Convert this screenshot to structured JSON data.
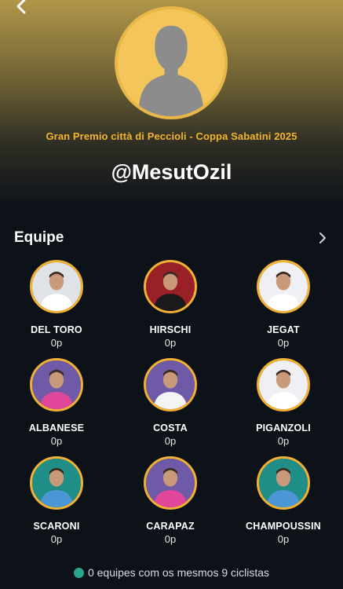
{
  "header": {
    "event_title": "Gran Premio città di Peccioli - Coppa Sabatini 2025",
    "username": "@MesutOzil"
  },
  "team": {
    "section_title": "Equipe",
    "riders": [
      {
        "name": "DEL TORO",
        "points": "0p",
        "jersey_color": "#ffffff",
        "bg": "#dfe3e8"
      },
      {
        "name": "HIRSCHI",
        "points": "0p",
        "jersey_color": "#1a1a1a",
        "bg": "#9a2027"
      },
      {
        "name": "JEGAT",
        "points": "0p",
        "jersey_color": "#ffffff",
        "bg": "#eef0f3"
      },
      {
        "name": "ALBANESE",
        "points": "0p",
        "jersey_color": "#e0479a",
        "bg": "#6e5aa6"
      },
      {
        "name": "COSTA",
        "points": "0p",
        "jersey_color": "#f4f4f4",
        "bg": "#6e5aa6"
      },
      {
        "name": "PIGANZOLI",
        "points": "0p",
        "jersey_color": "#ffffff",
        "bg": "#eef0f3"
      },
      {
        "name": "SCARONI",
        "points": "0p",
        "jersey_color": "#4b97d6",
        "bg": "#1f8e86"
      },
      {
        "name": "CARAPAZ",
        "points": "0p",
        "jersey_color": "#e0479a",
        "bg": "#6e5aa6"
      },
      {
        "name": "CHAMPOUSSIN",
        "points": "0p",
        "jersey_color": "#4b97d6",
        "bg": "#1f8e86"
      }
    ]
  },
  "footer": {
    "text": "0 equipes com os mesmos 9 ciclistas"
  },
  "colors": {
    "accent": "#f2b133",
    "background": "#0d1219",
    "status_dot": "#2aa58d"
  },
  "icons": {
    "back": "chevron-left-icon",
    "section_more": "chevron-right-icon",
    "avatar": "user-silhouette-icon"
  }
}
